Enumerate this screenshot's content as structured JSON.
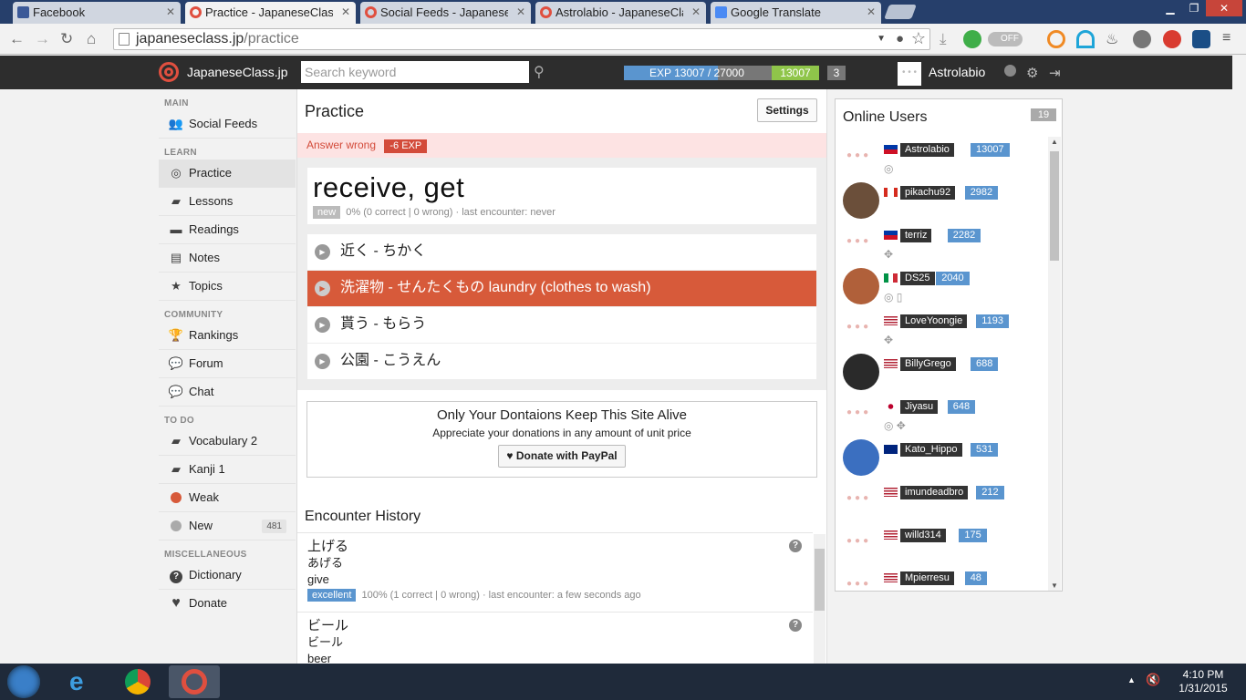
{
  "browser": {
    "tabs": [
      {
        "title": "Facebook",
        "favicon_color": "#3b5998"
      },
      {
        "title": "Practice - JapaneseClass.jp",
        "favicon_color": "#e04f3f"
      },
      {
        "title": "Social Feeds - JapaneseCla",
        "favicon_color": "#e04f3f"
      },
      {
        "title": "Astrolabio - JapaneseClass",
        "favicon_color": "#e04f3f"
      },
      {
        "title": "Google Translate",
        "favicon_color": "#4a8af4"
      }
    ],
    "tab_close": "✕",
    "url_host": "japaneseclass.jp",
    "url_path": "/practice",
    "toggle_label": "OFF"
  },
  "header": {
    "brand": "JapaneseClass.jp",
    "search_placeholder": "Search keyword",
    "exp_text": "EXP 13007 / 27000",
    "exp_progress": 0.482,
    "exp_value": "13007",
    "level": "3",
    "avatar_text": "• • •",
    "username": "Astrolabio"
  },
  "sidebar": {
    "main_title": "MAIN",
    "main": [
      {
        "label": "Social Feeds",
        "icon": "users-icon",
        "glyph": "👥"
      }
    ],
    "learn_title": "LEARN",
    "learn": [
      {
        "label": "Practice",
        "icon": "target-icon",
        "glyph": "◎"
      },
      {
        "label": "Lessons",
        "icon": "book-icon",
        "glyph": "▰"
      },
      {
        "label": "Readings",
        "icon": "reading-icon",
        "glyph": "▬"
      },
      {
        "label": "Notes",
        "icon": "note-icon",
        "glyph": "▤"
      },
      {
        "label": "Topics",
        "icon": "star-icon",
        "glyph": "★"
      }
    ],
    "community_title": "COMMUNITY",
    "community": [
      {
        "label": "Rankings",
        "icon": "trophy-icon",
        "glyph": "🏆"
      },
      {
        "label": "Forum",
        "icon": "chat-bubble-icon",
        "glyph": "💬"
      },
      {
        "label": "Chat",
        "icon": "chat-icon",
        "glyph": "💬"
      }
    ],
    "todo_title": "TO DO",
    "todo": [
      {
        "label": "Vocabulary 2",
        "icon": "book-icon"
      },
      {
        "label": "Kanji 1",
        "icon": "book-icon"
      },
      {
        "label": "Weak",
        "icon": "red-dot-icon"
      },
      {
        "label": "New",
        "icon": "grey-dot-icon",
        "badge": "481"
      }
    ],
    "misc_title": "MISCELLANEOUS",
    "misc": [
      {
        "label": "Dictionary",
        "icon": "question-icon",
        "glyph": "?"
      },
      {
        "label": "Donate",
        "icon": "heart-icon",
        "glyph": "♥"
      }
    ]
  },
  "practice": {
    "title": "Practice",
    "settings_label": "Settings",
    "answer_status": "Answer wrong",
    "exp_change": "-6 EXP",
    "question": "receive, get",
    "question_tag": "new",
    "question_stats": "0% (0 correct | 0 wrong)  ·  last encounter: never",
    "choices": [
      {
        "text": "近く - ちかく",
        "selected": false
      },
      {
        "text": "洗濯物 - せんたくもの  laundry (clothes to wash)",
        "selected": true
      },
      {
        "text": "貰う - もらう",
        "selected": false
      },
      {
        "text": "公園 - こうえん",
        "selected": false
      }
    ]
  },
  "donation": {
    "title": "Only Your Dontaions Keep This Site Alive",
    "subtitle": "Appreciate your donations in any amount of unit price",
    "button": "♥ Donate with PayPal"
  },
  "history": {
    "title": "Encounter History",
    "items": [
      {
        "word": "上げる",
        "reading": "あげる",
        "meaning": "give",
        "tag": "excellent",
        "stats": "100% (1 correct | 0 wrong)  ·  last encounter: a few seconds ago"
      },
      {
        "word": "ビール",
        "reading": "ビール",
        "meaning": "beer",
        "tag": "",
        "stats": ""
      }
    ]
  },
  "online": {
    "title": "Online Users",
    "count": "19",
    "users": [
      {
        "name": "Astrolabio",
        "exp": "13007",
        "flag": "ph",
        "avatar": "dots",
        "icons": "◎"
      },
      {
        "name": "pikachu92",
        "exp": "2982",
        "flag": "ca",
        "avatar": "image",
        "icons": ""
      },
      {
        "name": "terriz",
        "exp": "2282",
        "flag": "ph",
        "avatar": "dots",
        "icons": "✥"
      },
      {
        "name": "DS25",
        "exp": "2040",
        "flag": "it",
        "avatar": "image",
        "icons": "◎ ▯"
      },
      {
        "name": "LoveYoongie",
        "exp": "1193",
        "flag": "us",
        "avatar": "dots",
        "icons": "✥"
      },
      {
        "name": "BillyGrego",
        "exp": "688",
        "flag": "us",
        "avatar": "image",
        "icons": ""
      },
      {
        "name": "Jiyasu",
        "exp": "648",
        "flag": "jp",
        "avatar": "dots",
        "icons": "◎ ✥"
      },
      {
        "name": "Kato_Hippo",
        "exp": "531",
        "flag": "au",
        "avatar": "image",
        "icons": ""
      },
      {
        "name": "imundeadbro",
        "exp": "212",
        "flag": "us",
        "avatar": "dots",
        "icons": ""
      },
      {
        "name": "willd314",
        "exp": "175",
        "flag": "us",
        "avatar": "dots",
        "icons": ""
      },
      {
        "name": "Mpierresu",
        "exp": "48",
        "flag": "us",
        "avatar": "dots",
        "icons": ""
      }
    ]
  },
  "taskbar": {
    "time": "4:10 PM",
    "date": "1/31/2015"
  },
  "colors": {
    "accent": "#e04f3f",
    "selected_choice": "#d75a3a",
    "exp_blue": "#5a95cf",
    "exp_green": "#8fc54a"
  }
}
